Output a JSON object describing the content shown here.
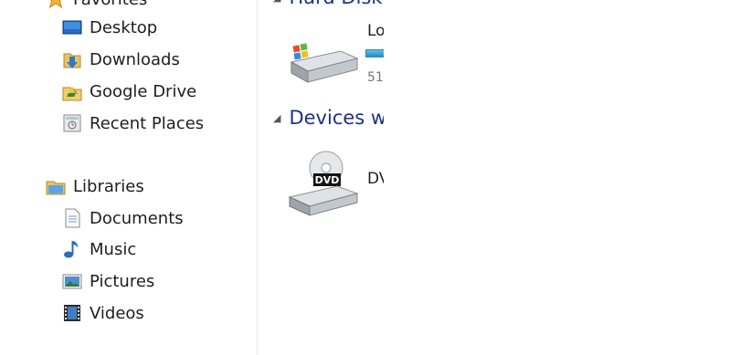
{
  "sidebar": {
    "favorites": {
      "label": "Favorites",
      "items": [
        {
          "label": "Desktop",
          "icon": "desktop-icon"
        },
        {
          "label": "Downloads",
          "icon": "downloads-folder-icon"
        },
        {
          "label": "Google Drive",
          "icon": "google-drive-icon"
        },
        {
          "label": "Recent Places",
          "icon": "recent-places-icon"
        }
      ]
    },
    "libraries": {
      "label": "Libraries",
      "items": [
        {
          "label": "Documents",
          "icon": "documents-icon"
        },
        {
          "label": "Music",
          "icon": "music-icon"
        },
        {
          "label": "Pictures",
          "icon": "pictures-icon"
        },
        {
          "label": "Videos",
          "icon": "videos-icon"
        }
      ]
    }
  },
  "content": {
    "hard_disk_group": {
      "label": "Hard Disk",
      "drive": {
        "label": "Lo",
        "size": "51",
        "icon": "windows-hard-drive-icon"
      }
    },
    "devices_group": {
      "label": "Devices w",
      "drive": {
        "label": "DV",
        "icon": "dvd-drive-icon",
        "badge": "DVD"
      }
    }
  },
  "colors": {
    "group_header": "#1e3287",
    "divider": "#dfe6ee",
    "drive_bar": "#1f8cc9"
  }
}
